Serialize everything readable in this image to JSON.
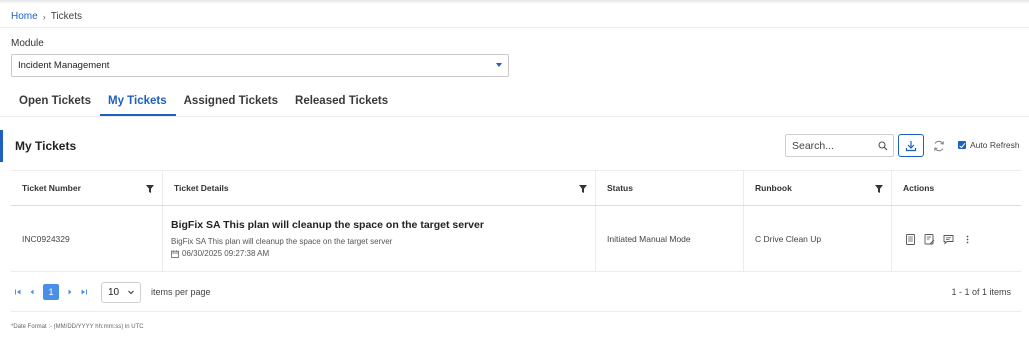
{
  "breadcrumb": {
    "home": "Home",
    "separator": "›",
    "current": "Tickets"
  },
  "module": {
    "label": "Module",
    "selected": "Incident Management"
  },
  "tabs": [
    {
      "label": "Open Tickets",
      "active": false
    },
    {
      "label": "My Tickets",
      "active": true
    },
    {
      "label": "Assigned Tickets",
      "active": false
    },
    {
      "label": "Released Tickets",
      "active": false
    }
  ],
  "section": {
    "title": "My Tickets"
  },
  "toolbar": {
    "search_placeholder": "Search...",
    "auto_refresh_label": "Auto Refresh",
    "auto_refresh_checked": true
  },
  "table": {
    "columns": [
      "Ticket Number",
      "Ticket Details",
      "Status",
      "Runbook",
      "Actions"
    ],
    "rows": [
      {
        "ticket_number": "INC0924329",
        "title": "BigFix SA This plan will cleanup the space on the target server",
        "description": "BigFix SA This plan will cleanup the space on the target server",
        "timestamp": "06/30/2025 09:27:38 AM",
        "status": "Initiated Manual Mode",
        "runbook": "C Drive Clean Up"
      }
    ]
  },
  "pagination": {
    "current_page": "1",
    "page_size": "10",
    "items_per_page_label": "items per page",
    "range_text": "1 - 1 of 1 items"
  },
  "footnote": "*Date Format :- (MM/DD/YYYY hh:mm:ss) in UTC",
  "colors": {
    "accent": "#1f5fbf",
    "page_active": "#4a8fe7"
  }
}
